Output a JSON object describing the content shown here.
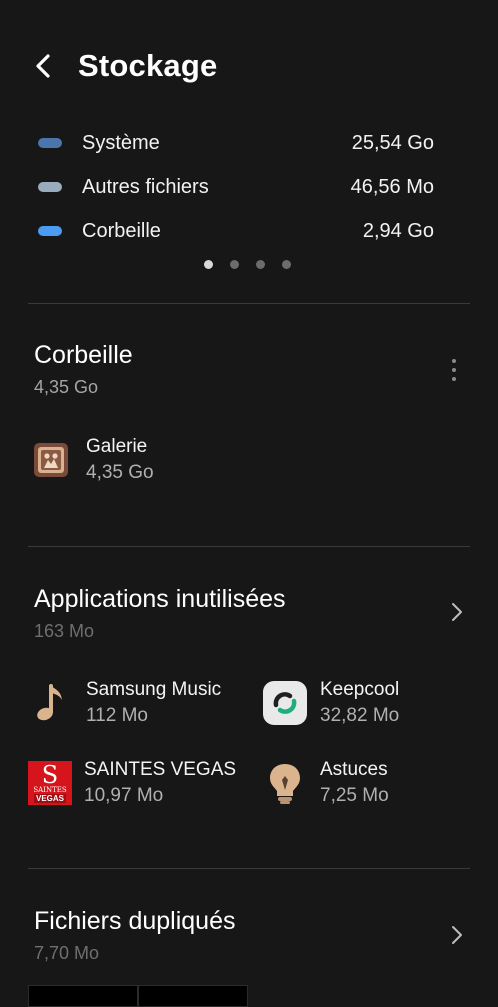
{
  "header": {
    "title": "Stockage"
  },
  "legend": [
    {
      "label": "Système",
      "value": "25,54 Go",
      "color": "#4a76ad"
    },
    {
      "label": "Autres fichiers",
      "value": "46,56 Mo",
      "color": "#9aabbc"
    },
    {
      "label": "Corbeille",
      "value": "2,94 Go",
      "color": "#4d9cf3"
    }
  ],
  "pager": {
    "count": 4,
    "active": 0
  },
  "trash": {
    "title": "Corbeille",
    "size": "4,35 Go",
    "items": [
      {
        "name": "Galerie",
        "size": "4,35 Go",
        "icon": "gallery-icon"
      }
    ]
  },
  "unused_apps": {
    "title": "Applications inutilisées",
    "size": "163 Mo",
    "apps": [
      {
        "name": "Samsung Music",
        "size": "112 Mo",
        "icon": "music-note-icon"
      },
      {
        "name": "Keepcool",
        "size": "32,82 Mo",
        "icon": "keepcool-icon"
      },
      {
        "name": "SAINTES VEGAS",
        "size": "10,97 Mo",
        "icon": "saintes-vegas-icon"
      },
      {
        "name": "Astuces",
        "size": "7,25 Mo",
        "icon": "lightbulb-icon"
      }
    ],
    "logo_text": {
      "letter": "S",
      "line1": "SAINTES",
      "line2": "VEGAS"
    }
  },
  "duplicates": {
    "title": "Fichiers dupliqués",
    "size": "7,70 Mo"
  }
}
